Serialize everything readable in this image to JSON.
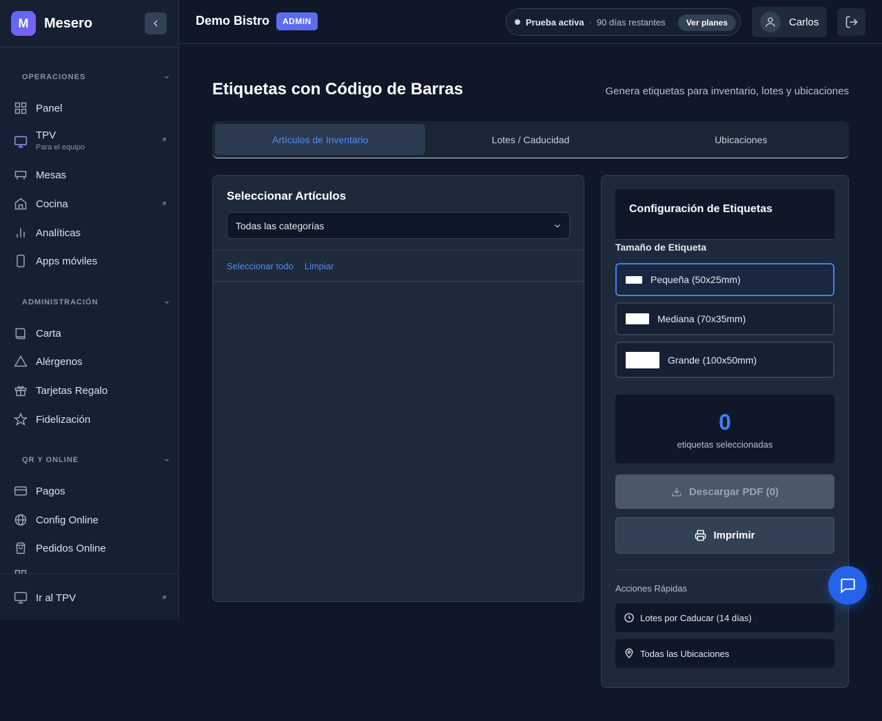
{
  "brand": {
    "logo_letter": "M",
    "name": "Mesero"
  },
  "sidebar": {
    "sections": [
      {
        "title": "OPERACIONES",
        "items": [
          {
            "label": "Panel",
            "icon": "grid-icon"
          },
          {
            "label": "TPV",
            "sublabel": "Para el equipo",
            "icon": "monitor-icon",
            "external": true
          },
          {
            "label": "Mesas",
            "icon": "table-icon"
          },
          {
            "label": "Cocina",
            "icon": "home-icon",
            "external": true
          },
          {
            "label": "Analíticas",
            "icon": "bar-chart-icon"
          },
          {
            "label": "Apps móviles",
            "icon": "smartphone-icon"
          }
        ]
      },
      {
        "title": "ADMINISTRACIÓN",
        "items": [
          {
            "label": "Carta",
            "icon": "book-icon"
          },
          {
            "label": "Alérgenos",
            "icon": "alert-triangle-icon"
          },
          {
            "label": "Tarjetas Regalo",
            "icon": "gift-icon"
          },
          {
            "label": "Fidelización",
            "icon": "star-icon"
          }
        ]
      },
      {
        "title": "QR Y ONLINE",
        "items": [
          {
            "label": "Pagos",
            "icon": "credit-card-icon"
          },
          {
            "label": "Config Online",
            "icon": "globe-icon"
          },
          {
            "label": "Pedidos Online",
            "icon": "shopping-bag-icon"
          }
        ]
      }
    ],
    "footer": {
      "label": "Ir al TPV",
      "icon": "monitor-icon"
    }
  },
  "header": {
    "restaurant": "Demo Bistro",
    "role_badge": "ADMIN",
    "trial_status": "Prueba activa",
    "trial_separator": "·",
    "trial_days": "90 días restantes",
    "plans_button": "Ver planes",
    "user_name": "Carlos"
  },
  "page": {
    "title": "Etiquetas con Código de Barras",
    "subtitle": "Genera etiquetas para inventario, lotes y ubicaciones",
    "tabs": [
      {
        "label": "Artículos de Inventario",
        "active": true
      },
      {
        "label": "Lotes / Caducidad",
        "active": false
      },
      {
        "label": "Ubicaciones",
        "active": false
      }
    ]
  },
  "select_panel": {
    "title": "Seleccionar Artículos",
    "category_value": "Todas las categorías",
    "select_all": "Seleccionar todo",
    "clear": "Limpiar"
  },
  "config_panel": {
    "title": "Configuración de Etiquetas",
    "size_label": "Tamaño de Etiqueta",
    "sizes": [
      {
        "label": "Pequeña (50x25mm)",
        "selected": true
      },
      {
        "label": "Mediana (70x35mm)",
        "selected": false
      },
      {
        "label": "Grande (100x50mm)",
        "selected": false
      }
    ],
    "count": "0",
    "count_label": "etiquetas seleccionadas",
    "download_button": "Descargar PDF (0)",
    "print_button": "Imprimir",
    "quick_actions_title": "Acciones Rápidas",
    "quick_actions": [
      {
        "label": "Lotes por Caducar (14 días)",
        "icon": "clock-icon"
      },
      {
        "label": "Todas las Ubicaciones",
        "icon": "map-pin-icon"
      }
    ]
  },
  "colors": {
    "accent": "#3b82f6",
    "background": "#0f1729",
    "panel": "#1e293b",
    "brand_gradient_start": "#4f6cf7",
    "brand_gradient_end": "#8b5cf6"
  }
}
